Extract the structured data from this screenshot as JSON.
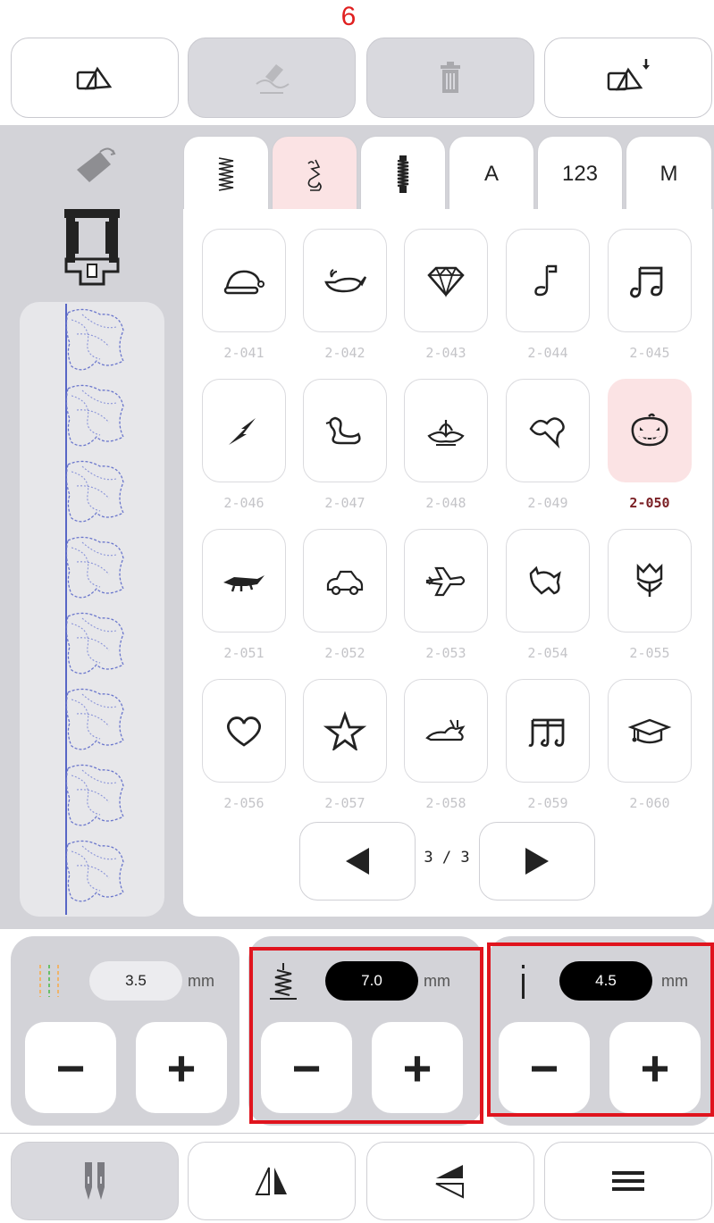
{
  "step_label": "6",
  "toolbar": {
    "items": [
      {
        "name": "load-design-icon",
        "state": "enabled"
      },
      {
        "name": "edit-stitch-icon",
        "state": "disabled"
      },
      {
        "name": "trash-icon",
        "state": "disabled"
      },
      {
        "name": "save-design-icon",
        "state": "enabled"
      }
    ]
  },
  "tabs": [
    {
      "name": "utility-stitches-icon",
      "label": ""
    },
    {
      "name": "decorative-stitches-icon",
      "label": "",
      "active": true
    },
    {
      "name": "buttonhole-icon",
      "label": ""
    },
    {
      "name": "alphabet-tab",
      "label": "A"
    },
    {
      "name": "numbers-tab",
      "label": "123"
    },
    {
      "name": "memory-tab",
      "label": "M"
    }
  ],
  "stitches": [
    {
      "code": "2-041",
      "icon": "santa-hat-icon"
    },
    {
      "code": "2-042",
      "icon": "whale-icon"
    },
    {
      "code": "2-043",
      "icon": "diamond-icon"
    },
    {
      "code": "2-044",
      "icon": "music-note-icon"
    },
    {
      "code": "2-045",
      "icon": "double-note-icon"
    },
    {
      "code": "2-046",
      "icon": "lightning-icon"
    },
    {
      "code": "2-047",
      "icon": "swan-icon"
    },
    {
      "code": "2-048",
      "icon": "lotus-icon"
    },
    {
      "code": "2-049",
      "icon": "leaf-icon"
    },
    {
      "code": "2-050",
      "icon": "pumpkin-icon",
      "selected": true
    },
    {
      "code": "2-051",
      "icon": "alligator-icon"
    },
    {
      "code": "2-052",
      "icon": "car-icon"
    },
    {
      "code": "2-053",
      "icon": "airplane-icon"
    },
    {
      "code": "2-054",
      "icon": "cat-icon"
    },
    {
      "code": "2-055",
      "icon": "tulip-icon"
    },
    {
      "code": "2-056",
      "icon": "heart-icon"
    },
    {
      "code": "2-057",
      "icon": "star-icon"
    },
    {
      "code": "2-058",
      "icon": "rabbit-icon"
    },
    {
      "code": "2-059",
      "icon": "triple-note-icon"
    },
    {
      "code": "2-060",
      "icon": "graduation-cap-icon"
    }
  ],
  "pagination": {
    "text": "3 / 3"
  },
  "settings": {
    "needle_position": {
      "value": "3.5",
      "unit": "mm",
      "icon": "needle-position-icon"
    },
    "stitch_width": {
      "value": "7.0",
      "unit": "mm",
      "icon": "stitch-width-icon"
    },
    "stitch_length": {
      "value": "4.5",
      "unit": "mm",
      "icon": "stitch-length-icon"
    },
    "minus_label": "−",
    "plus_label": "+"
  },
  "bottom_bar": {
    "items": [
      {
        "name": "twin-needle-icon",
        "state": "active"
      },
      {
        "name": "mirror-horizontal-icon",
        "state": "normal"
      },
      {
        "name": "mirror-vertical-icon",
        "state": "normal"
      },
      {
        "name": "menu-icon",
        "state": "normal"
      }
    ]
  },
  "colors": {
    "accent_pink": "#fbe3e4",
    "selected_code": "#7a1f24",
    "highlight_red": "#e0141e",
    "panel_grey": "#d3d3d8",
    "stitch_preview": "#5866c6"
  }
}
